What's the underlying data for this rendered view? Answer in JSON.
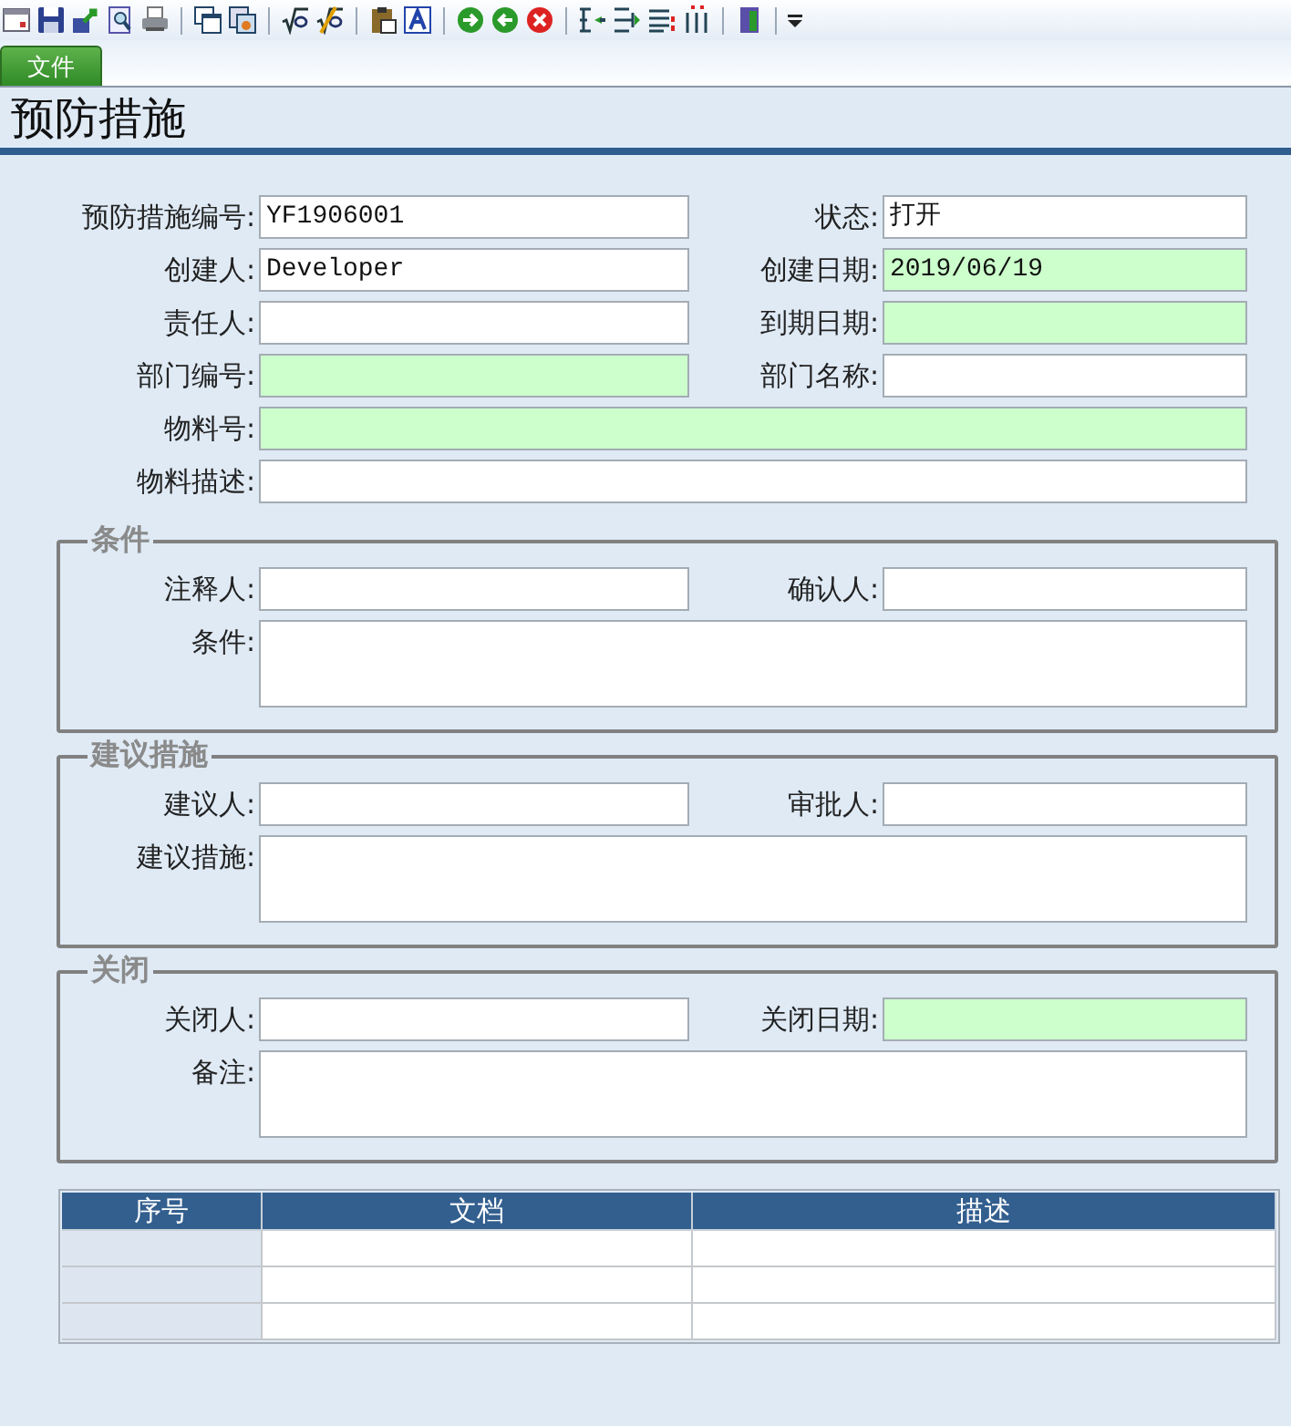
{
  "menu_tabs": [
    {
      "label": "文件",
      "selected": true
    }
  ],
  "page_title": "预防措施",
  "main_fields": [
    {
      "label": "预防措施编号:",
      "value": "YF1906001",
      "kind": "short",
      "required": false
    },
    {
      "label": "状态:",
      "value": "打开",
      "kind": "short",
      "required": false
    },
    {
      "label": "创建人:",
      "value": "Developer",
      "kind": "short",
      "required": false
    },
    {
      "label": "创建日期:",
      "value": "2019/06/19",
      "kind": "short",
      "required": true
    },
    {
      "label": "责任人:",
      "kind": "short",
      "required": false
    },
    {
      "label": "到期日期:",
      "kind": "short",
      "required": true
    },
    {
      "label": "部门编号:",
      "kind": "short",
      "required": true
    },
    {
      "label": "部门名称:",
      "kind": "short",
      "required": false
    },
    {
      "label": "物料号:",
      "kind": "long",
      "required": true
    },
    {
      "label": "物料描述:",
      "kind": "long",
      "required": false
    }
  ],
  "groups": [
    {
      "title": "条件",
      "fields": [
        {
          "label": "注释人:",
          "kind": "short",
          "required": false
        },
        {
          "label": "确认人:",
          "kind": "short",
          "required": false
        },
        {
          "label": "条件:",
          "kind": "area",
          "required": false
        }
      ]
    },
    {
      "title": "建议措施",
      "fields": [
        {
          "label": "建议人:",
          "kind": "short",
          "required": false
        },
        {
          "label": "审批人:",
          "kind": "short",
          "required": false
        },
        {
          "label": "建议措施:",
          "kind": "area",
          "required": false
        }
      ]
    },
    {
      "title": "关闭",
      "fields": [
        {
          "label": "关闭人:",
          "kind": "short",
          "required": false
        },
        {
          "label": "关闭日期:",
          "kind": "short",
          "required": true
        },
        {
          "label": "备注:",
          "kind": "area",
          "required": false
        }
      ]
    }
  ],
  "documents_table": {
    "columns": [
      "序号",
      "文档",
      "描述"
    ]
  }
}
